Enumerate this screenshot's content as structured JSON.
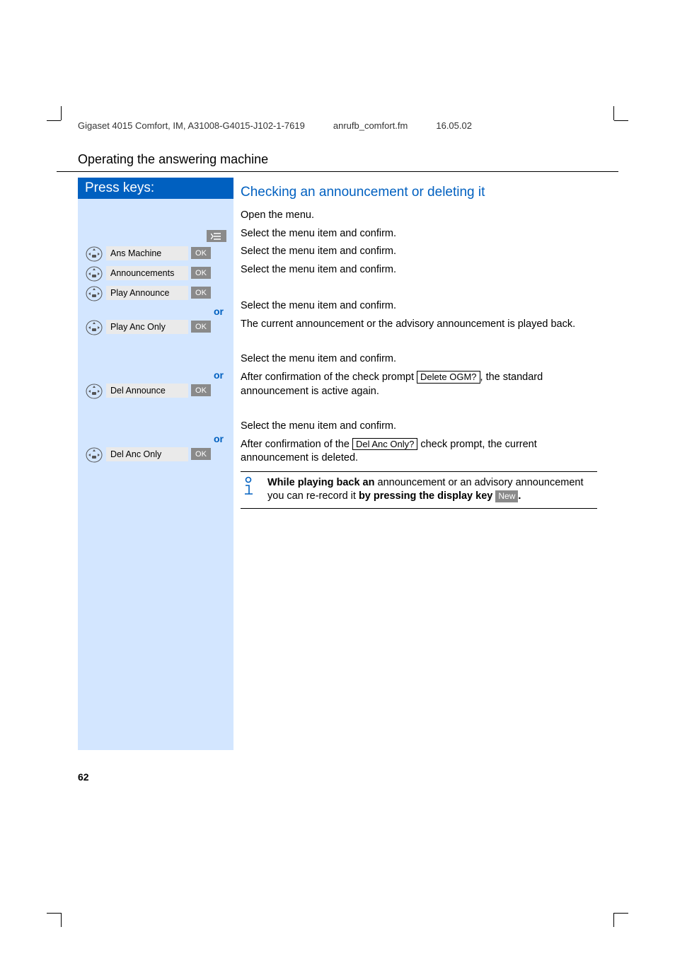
{
  "header": {
    "doc_ref": "Gigaset 4015 Comfort, IM, A31008-G4015-J102-1-7619",
    "filename": "anrufb_comfort.fm",
    "date": "16.05.02"
  },
  "section_title": "Operating the answering machine",
  "press_keys_label": "Press keys:",
  "blue_heading": "Checking an announcement or deleting it",
  "menu_items": {
    "ans_machine": "Ans Machine",
    "announcements": "Announcements",
    "play_announce": "Play Announce",
    "play_anc_only": "Play Anc Only",
    "del_announce": "Del Announce",
    "del_anc_only": "Del Anc Only"
  },
  "ok_label": "OK",
  "or_label": "or",
  "right": {
    "open_menu": "Open the menu.",
    "select_confirm": "Select the menu item and confirm.",
    "current_played": "The current announcement or the advisory announcement is played back.",
    "after_conf_prefix": "After confirmation of the check prompt ",
    "delete_ogm_box": "Delete OGM?",
    "after_conf_suffix": ", the standard announcement is active again.",
    "after_conf2_prefix": "After confirmation of the ",
    "del_anc_only_box": "Del Anc Only?",
    "after_conf2_suffix": " check prompt, the current announcement is deleted."
  },
  "info": {
    "bold1": "While playing back an",
    "mid": " announcement or an advisory announcement you can re-record it ",
    "bold2": "by pressing the display key ",
    "new_label": "New",
    "period": "."
  },
  "page_number": "62"
}
